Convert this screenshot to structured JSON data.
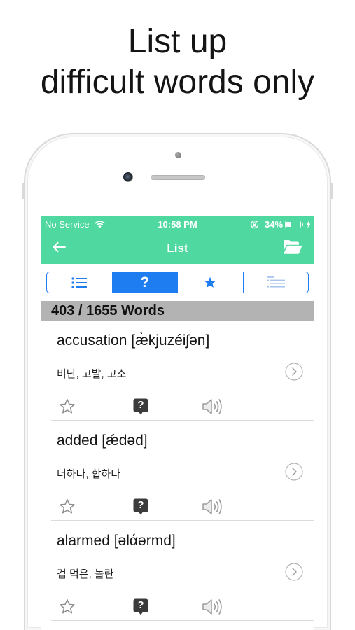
{
  "headline": {
    "line1": "List up",
    "line2": "difficult words only"
  },
  "colors": {
    "brand_green": "#4fd8a0",
    "segment_blue": "#1e7df0",
    "count_bar_gray": "#b3b3b3",
    "quiz_icon_dark": "#3b3b3b"
  },
  "status_bar": {
    "carrier": "No Service",
    "time": "10:58 PM",
    "battery": "34%",
    "icons": {
      "signal": "wifi-icon",
      "lock": "orientation-lock-icon",
      "battery": "battery-icon",
      "charging": "charging-bolt-icon"
    }
  },
  "nav": {
    "title": "List",
    "left_icon": "back-arrow-icon",
    "right_icon": "folder-open-icon"
  },
  "segments": [
    {
      "icon": "list-bullet-icon",
      "selected": false
    },
    {
      "icon": "question-mark-icon",
      "glyph": "?",
      "selected": true
    },
    {
      "icon": "star-icon",
      "selected": false
    },
    {
      "icon": "list-lines-icon",
      "selected": false
    }
  ],
  "word_count": "403 / 1655 Words",
  "row_actions": {
    "star": "star-outline-icon",
    "quiz": "quiz-question-icon",
    "quiz_glyph": "?",
    "audio": "speaker-icon",
    "detail": "chevron-right-circle-icon"
  },
  "words": [
    {
      "term": "accusation [æ̀kjuzéiʃən]",
      "meaning": "비난, 고발, 고소"
    },
    {
      "term": "added [ǽdəd]",
      "meaning": "더하다, 합하다"
    },
    {
      "term": "alarmed [əlάərmd]",
      "meaning": "겁 먹은, 놀란"
    }
  ]
}
